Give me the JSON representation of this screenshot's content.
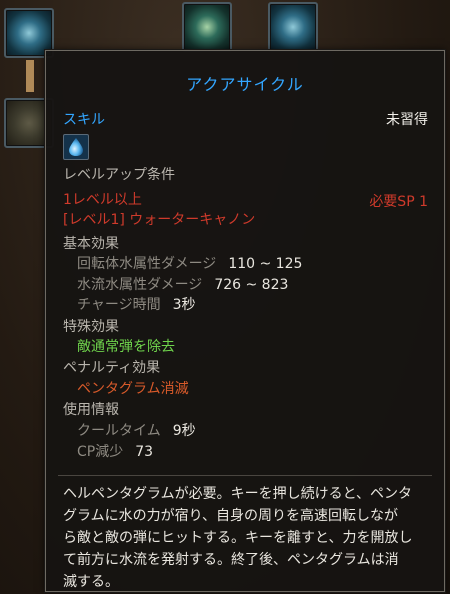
{
  "tooltip": {
    "title": "アクアサイクル",
    "skill_type": "スキル",
    "acquired_status": "未習得",
    "levelup_header": "レベルアップ条件",
    "req_level": "1レベル以上",
    "req_sp": "必要SP 1",
    "req_skill": "[レベル1] ウォーターキャノン",
    "basic_effect": {
      "header": "基本効果",
      "items": [
        {
          "label": "回転体水属性ダメージ",
          "value": "110 ~ 125"
        },
        {
          "label": "水流水属性ダメージ",
          "value": "726 ~ 823"
        },
        {
          "label": "チャージ時間",
          "value": "3秒"
        }
      ]
    },
    "special_effect": {
      "header": "特殊効果",
      "text": "敵通常弾を除去"
    },
    "penalty_effect": {
      "header": "ペナルティ効果",
      "text": "ペンタグラム消滅"
    },
    "usage_info": {
      "header": "使用情報",
      "items": [
        {
          "label": "クールタイム",
          "value": "9秒"
        },
        {
          "label": "CP減少",
          "value": "73"
        }
      ]
    },
    "description_lines": [
      "ヘルペンタグラムが必要。キーを押し続けると、ペンタ",
      "グラムに水の力が宿り、自身の周りを高速回転しなが",
      "ら敵と敵の弾にヒットする。キーを離すと、力を開放し",
      "て前方に水流を発射する。終了後、ペンタグラムは消",
      "滅する。"
    ]
  },
  "colors": {
    "title": "#33a6ff",
    "requirement": "#cf3a2b",
    "special": "#6fd34c",
    "penalty": "#d85a2a"
  },
  "icons": {
    "skill_icon": "water-drop-icon"
  }
}
